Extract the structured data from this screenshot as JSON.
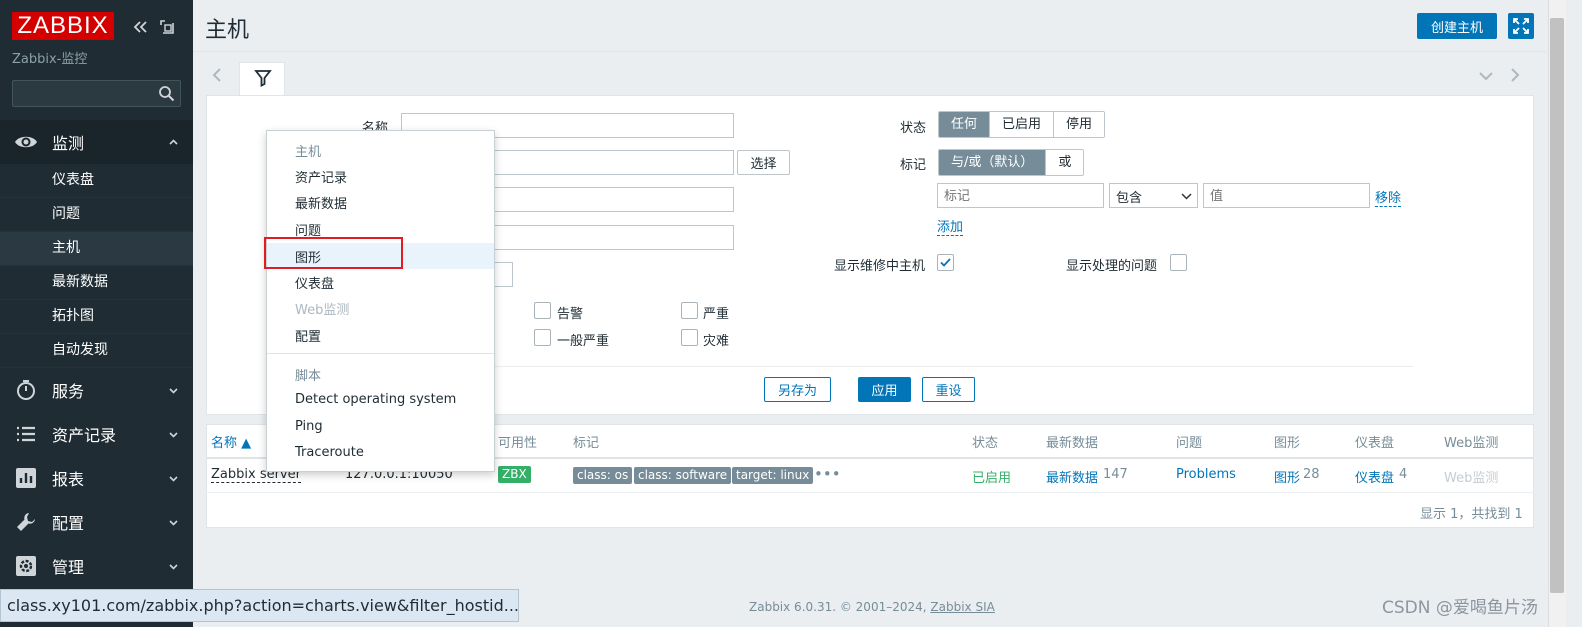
{
  "brand": {
    "logo": "ZABBIX",
    "server_name": "Zabbix-监控"
  },
  "sidebar": {
    "search_value": "",
    "sections": [
      {
        "label": "监测",
        "icon": "eye-icon",
        "expanded": true
      },
      {
        "label": "服务",
        "icon": "clock-icon"
      },
      {
        "label": "资产记录",
        "icon": "list-icon"
      },
      {
        "label": "报表",
        "icon": "bar-chart-icon"
      },
      {
        "label": "配置",
        "icon": "wrench-icon"
      },
      {
        "label": "管理",
        "icon": "gear-icon"
      }
    ],
    "sub_items": [
      "仪表盘",
      "问题",
      "主机",
      "最新数据",
      "拓扑图",
      "自动发现"
    ],
    "active_sub": "主机"
  },
  "header": {
    "title": "主机",
    "create_button": "创建主机"
  },
  "filter": {
    "name_label": "名称",
    "select_button": "选择",
    "status_label": "状态",
    "status_options": [
      "任何",
      "已启用",
      "停用"
    ],
    "status_selected": "任何",
    "tags_label": "标记",
    "tags_options": [
      "与/或（默认）",
      "或"
    ],
    "tags_selected": "与/或（默认）",
    "tag_placeholder": "标记",
    "tag_operator": "包含",
    "tag_value_placeholder": "值",
    "remove_link": "移除",
    "add_link": "添加",
    "maintenance_label": "显示维修中主机",
    "maintenance_checked": true,
    "suppressed_label": "显示处理的问题",
    "suppressed_checked": false,
    "severities": [
      "告警",
      "严重",
      "一般严重",
      "灾难"
    ],
    "save_as": "另存为",
    "apply": "应用",
    "reset": "重设"
  },
  "table": {
    "headers": [
      "名称 ▲",
      "可用性",
      "标记",
      "状态",
      "最新数据",
      "问题",
      "图形",
      "仪表盘",
      "Web监测"
    ],
    "rows": [
      {
        "name": "Zabbix server",
        "interface": "127.0.0.1:10050",
        "availability": "ZBX",
        "tags": [
          "class: os",
          "class: software",
          "target: linux"
        ],
        "tags_more": "•••",
        "status": "已启用",
        "latest_data": "最新数据",
        "latest_count": "147",
        "problems": "Problems",
        "graphs": "图形",
        "graphs_count": "28",
        "dashboards": "仪表盘",
        "dashboards_count": "4",
        "web": "Web监测"
      }
    ],
    "footer": "显示 1，共找到 1"
  },
  "context_menu": {
    "host_header": "主机",
    "items": [
      {
        "label": "资产记录",
        "enabled": true
      },
      {
        "label": "最新数据",
        "enabled": true
      },
      {
        "label": "问题",
        "enabled": true
      },
      {
        "label": "图形",
        "enabled": true,
        "highlighted": true
      },
      {
        "label": "仪表盘",
        "enabled": true
      },
      {
        "label": "Web监测",
        "enabled": false
      },
      {
        "label": "配置",
        "enabled": true
      }
    ],
    "scripts_header": "脚本",
    "scripts": [
      "Detect operating system",
      "Ping",
      "Traceroute"
    ]
  },
  "status_bar_url": "class.xy101.com/zabbix.php?action=charts.view&filter_hostid...",
  "footer": {
    "copyright": "Zabbix 6.0.31. © 2001–2024,",
    "company": "Zabbix SIA"
  },
  "watermark": "CSDN @爱喝鱼片汤",
  "colors": {
    "sidebar": "#1f2c33",
    "accent": "#0275b8",
    "brand_red": "#d40000",
    "status_green": "#34af67",
    "tag_gray": "#768d99",
    "highlight_box": "#e31b23"
  }
}
